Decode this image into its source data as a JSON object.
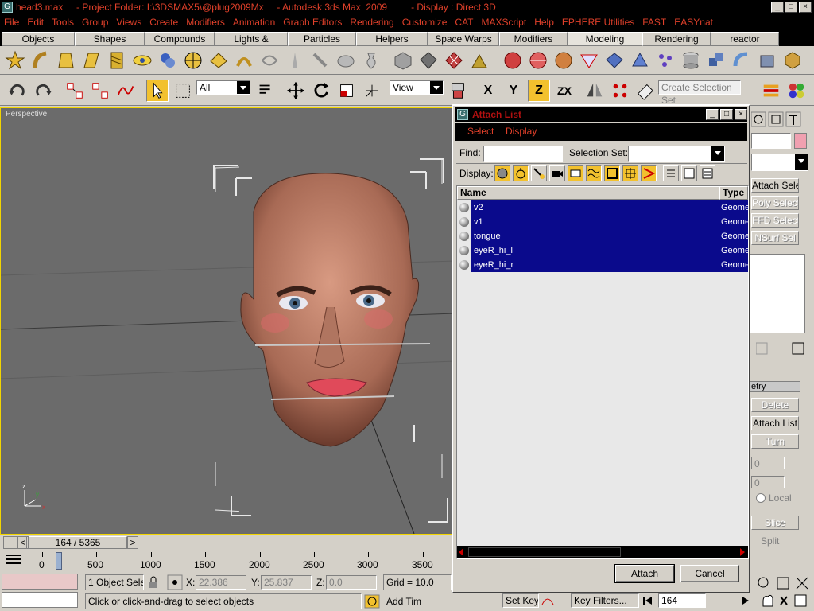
{
  "window": {
    "title": "head3.max     - Project Folder: I:\\3DSMAX5\\@plug2009Mx     - Autodesk 3ds Max  2009         - Display : Direct 3D",
    "controls": [
      "_",
      "□",
      "×"
    ]
  },
  "menubar": [
    "File",
    "Edit",
    "Tools",
    "Group",
    "Views",
    "Create",
    "Modifiers",
    "Animation",
    "Graph Editors",
    "Rendering",
    "Customize",
    "CAT",
    "MAXScript",
    "Help",
    "EPHERE Utilities",
    "FAST",
    "EASYnat"
  ],
  "tabs": [
    "Objects",
    "Shapes",
    "Compounds",
    "Lights & Cameras",
    "Particles",
    "Helpers",
    "Space Warps",
    "Modifiers",
    "Modeling",
    "Rendering",
    "reactor"
  ],
  "active_tab": "Modeling",
  "toolbar": {
    "filter_value": "All",
    "reference_value": "View",
    "selection_set_placeholder": "Create Selection Set",
    "axis_x": "X",
    "axis_y": "Y",
    "axis_z": "Z",
    "axis_zx": "ZX"
  },
  "viewport": {
    "label": "Perspective",
    "gizmo_axis_label": "z",
    "axis_x": "x",
    "axis_y": "y",
    "axis_z": "z"
  },
  "right_panel": {
    "buttons": [
      "Attach Select",
      "Poly Select",
      "FFD Select",
      "NSurf Sel"
    ],
    "rollout_title": "etry",
    "buttons2": [
      "Delete",
      "Attach List",
      "Turn"
    ],
    "local_label": "Local",
    "slice": "Slice",
    "split": "Split",
    "spinner_value_1": "0",
    "spinner_value_2": "0"
  },
  "timeline": {
    "frame_display": "164 / 5365",
    "prev": "<",
    "next": ">",
    "ticks": [
      "0",
      "500",
      "1000",
      "1500",
      "2000",
      "2500",
      "3000",
      "3500"
    ]
  },
  "status": {
    "selection": "1 Object Sele",
    "x_label": "X:",
    "x_value": "22.386",
    "y_label": "Y:",
    "y_value": "25.837",
    "z_label": "Z:",
    "z_value": "0.0",
    "grid": "Grid = 10.0",
    "prompt": "Click or click-and-drag to select objects",
    "add_time": "Add Tim",
    "set_key": "Set Key",
    "key_filters": "Key Filters...",
    "frame": "164"
  },
  "dialog": {
    "title": "Attach List",
    "menu": [
      "Select",
      "Display"
    ],
    "find_label": "Find:",
    "find_value": "",
    "selection_set_label": "Selection Set:",
    "display_label": "Display:",
    "columns": [
      "Name",
      "Type"
    ],
    "rows": [
      {
        "name": "v2",
        "type": "Geometry"
      },
      {
        "name": "v1",
        "type": "Geometry"
      },
      {
        "name": "tongue",
        "type": "Geometry"
      },
      {
        "name": "eyeR_hi_l",
        "type": "Geometry"
      },
      {
        "name": "eyeR_hi_r",
        "type": "Geometry"
      }
    ],
    "attach_button": "Attach",
    "cancel_button": "Cancel"
  },
  "colors": {
    "menu_text": "#e0402a",
    "selection_highlight": "#0a0a8c",
    "active_tool": "#f2c12e",
    "viewport_border": "#f2d500",
    "dialog_title_text": "#b01010"
  }
}
